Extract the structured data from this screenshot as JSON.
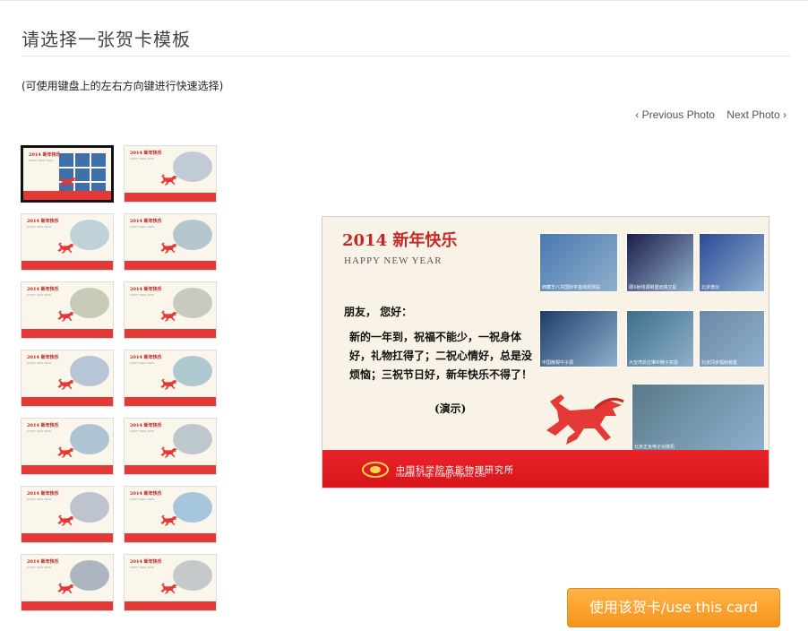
{
  "page": {
    "title": "请选择一张贺卡模板",
    "hint": "(可使用键盘上的左右方向键进行快速选择)"
  },
  "nav": {
    "prev": "‹ Previous Photo",
    "next": "Next Photo ›"
  },
  "thumbnails": [
    {
      "name": "card-1",
      "tint": "#5a7fb0",
      "selected": true
    },
    {
      "name": "card-2",
      "tint": "#8fa7c4"
    },
    {
      "name": "card-3",
      "tint": "#8fb3c6"
    },
    {
      "name": "card-4",
      "tint": "#7aa0b8"
    },
    {
      "name": "card-5",
      "tint": "#9aa58c"
    },
    {
      "name": "card-6",
      "tint": "#9aa69a"
    },
    {
      "name": "card-7",
      "tint": "#7e9fc4"
    },
    {
      "name": "card-8",
      "tint": "#6fa3b8"
    },
    {
      "name": "card-9",
      "tint": "#6c9ac0"
    },
    {
      "name": "card-10",
      "tint": "#8aa0b6"
    },
    {
      "name": "card-11",
      "tint": "#8a9bb6"
    },
    {
      "name": "card-12",
      "tint": "#5f9ed0"
    },
    {
      "name": "card-13",
      "tint": "#6e7f9c"
    },
    {
      "name": "card-14",
      "tint": "#9aa4b0"
    }
  ],
  "card": {
    "title": "2014 新年快乐",
    "subtitle": "HAPPY NEW YEAR",
    "greeting": "朋友， 您好：",
    "body": "新的一年到，祝福不能少，一祝身体好，礼物扛得了；二祝心情好，总是没烦恼；三祝节日好，新年快乐不得了！",
    "signature": "(演示)",
    "institute_cn": "中国科学院高能物理研究所",
    "institute_en": "Institute of High Energy Physics, CAS",
    "photos": [
      {
        "caption": "西藏羊八井国际宇宙线观测站",
        "color": "#4a78b0"
      },
      {
        "caption": "硬X射线调制望远镜卫星",
        "color": "#1d1d4a"
      },
      {
        "caption": "北京谱仪",
        "color": "#2a4a9a"
      },
      {
        "caption": "中国散裂中子源",
        "color": "#1e3c6a"
      },
      {
        "caption": "大亚湾反应堆中微子实验",
        "color": "#3d6e8a"
      },
      {
        "caption": "北京同步辐射装置",
        "color": "#6c88a8"
      },
      {
        "caption": "北京正负电子对撞机",
        "color": "#5a7a8a"
      }
    ]
  },
  "button": {
    "label": "使用该贺卡/use this card"
  },
  "colors": {
    "accent_orange": "#f7941d",
    "card_red": "#e31e24"
  }
}
